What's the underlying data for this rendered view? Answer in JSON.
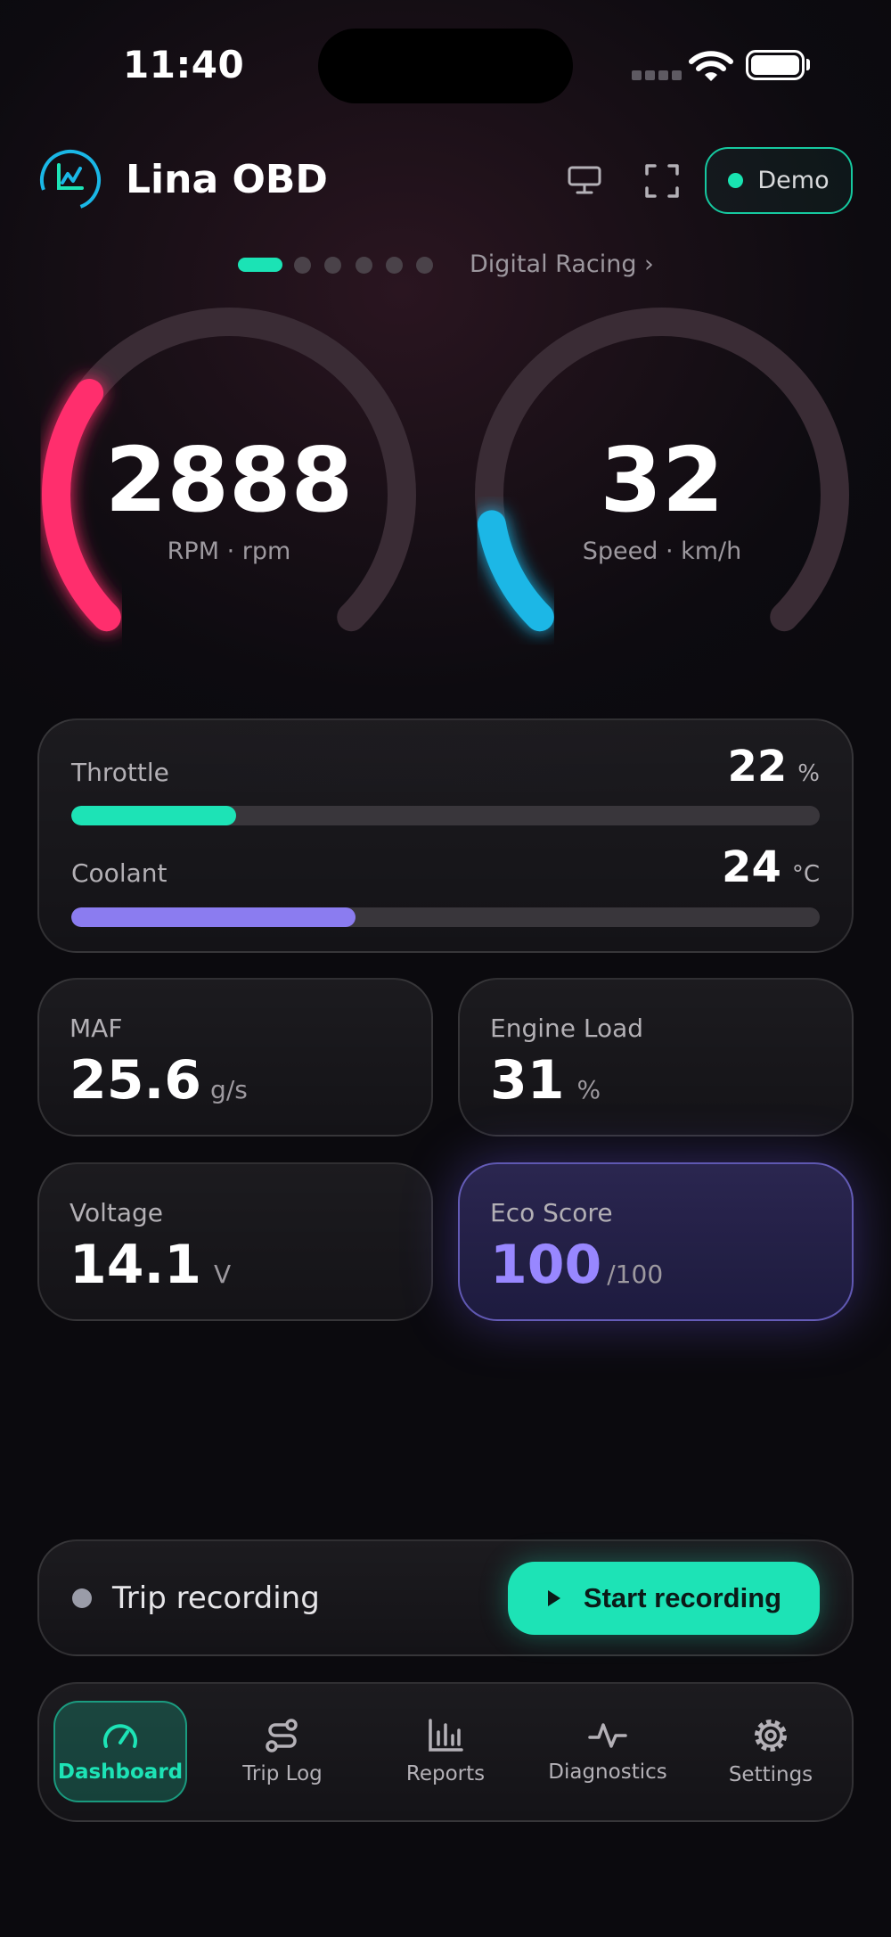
{
  "status_bar": {
    "time": "11:40"
  },
  "header": {
    "app_title": "Lina OBD",
    "demo_label": "Demo"
  },
  "pager": {
    "layout_name": "Digital Racing ›"
  },
  "gauges": [
    {
      "value": "2888",
      "label": "RPM · rpm",
      "fraction": 0.3,
      "color": "#ff2f6d"
    },
    {
      "value": "32",
      "label": "Speed · km/h",
      "fraction": 0.13,
      "color": "#1ab7e6"
    }
  ],
  "bars": {
    "throttle": {
      "label": "Throttle",
      "value": "22",
      "unit": "%",
      "fraction": 0.22,
      "color": "#1de3b6"
    },
    "coolant": {
      "label": "Coolant",
      "value": "24",
      "unit": "°C",
      "fraction": 0.38,
      "color": "#8b7cf0"
    }
  },
  "stats": {
    "maf": {
      "label": "MAF",
      "value": "25.6",
      "unit": "g/s"
    },
    "engine_load": {
      "label": "Engine Load",
      "value": "31",
      "unit": "%"
    },
    "voltage": {
      "label": "Voltage",
      "value": "14.1",
      "unit": "V"
    },
    "eco_score": {
      "label": "Eco Score",
      "value": "100",
      "unit": "/100",
      "color": "#9887ff"
    }
  },
  "trip": {
    "label": "Trip recording",
    "button_label": "Start recording"
  },
  "nav": {
    "items": [
      {
        "label": "Dashboard",
        "icon": "speedometer-icon",
        "active": true
      },
      {
        "label": "Trip Log",
        "icon": "route-icon"
      },
      {
        "label": "Reports",
        "icon": "bar-chart-icon"
      },
      {
        "label": "Diagnostics",
        "icon": "pulse-icon"
      },
      {
        "label": "Settings",
        "icon": "gear-icon"
      }
    ]
  },
  "colors": {
    "accent": "#1de3b6",
    "rpm": "#ff2f6d",
    "speed": "#1ab7e6",
    "coolant": "#8b7cf0",
    "eco": "#9887ff"
  }
}
